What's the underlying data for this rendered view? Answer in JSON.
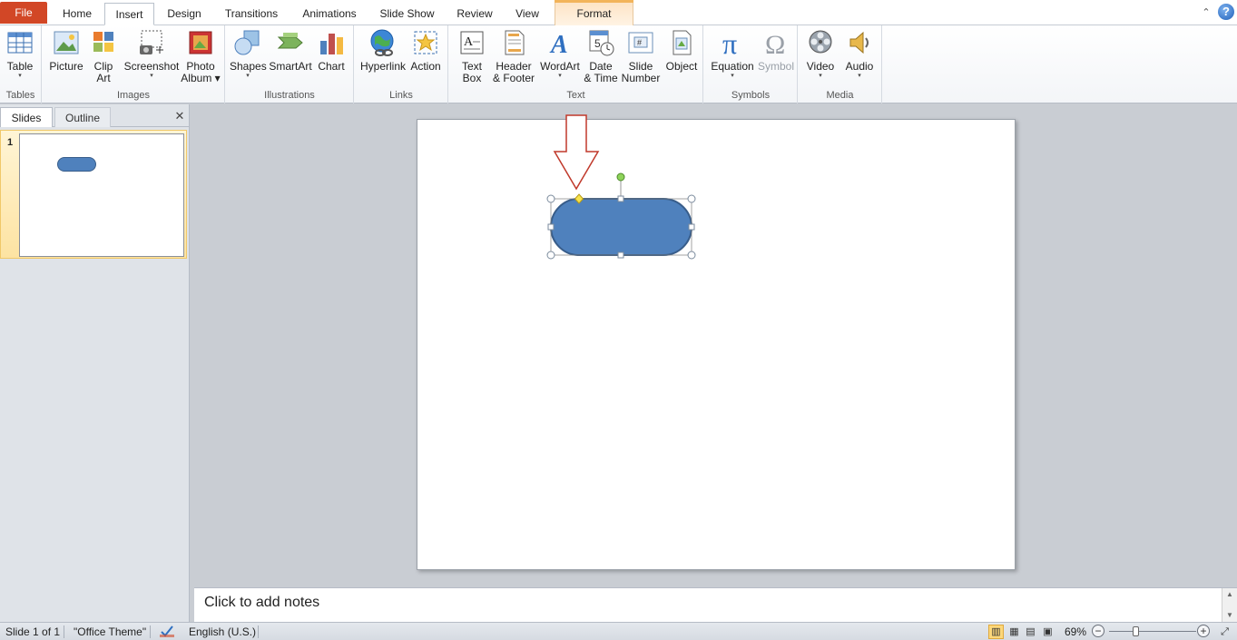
{
  "tabs": {
    "file": "File",
    "home": "Home",
    "insert": "Insert",
    "design": "Design",
    "transitions": "Transitions",
    "animations": "Animations",
    "slideshow": "Slide Show",
    "review": "Review",
    "view": "View",
    "format": "Format"
  },
  "ribbon": {
    "groups": {
      "tables": "Tables",
      "images": "Images",
      "illustrations": "Illustrations",
      "links": "Links",
      "text": "Text",
      "symbols": "Symbols",
      "media": "Media"
    },
    "buttons": {
      "table": "Table",
      "picture": "Picture",
      "clipart_1": "Clip",
      "clipart_2": "Art",
      "screenshot": "Screenshot",
      "photoalbum_1": "Photo",
      "photoalbum_2": "Album",
      "shapes": "Shapes",
      "smartart": "SmartArt",
      "chart": "Chart",
      "hyperlink": "Hyperlink",
      "action": "Action",
      "textbox_1": "Text",
      "textbox_2": "Box",
      "headerfooter_1": "Header",
      "headerfooter_2": "& Footer",
      "wordart": "WordArt",
      "datetime_1": "Date",
      "datetime_2": "& Time",
      "slidenumber_1": "Slide",
      "slidenumber_2": "Number",
      "object": "Object",
      "equation": "Equation",
      "symbol": "Symbol",
      "video": "Video",
      "audio": "Audio"
    },
    "dropdown_glyph": "▾"
  },
  "left_panel": {
    "tab_slides": "Slides",
    "tab_outline": "Outline",
    "close_glyph": "✕",
    "slide_number": "1"
  },
  "notes": {
    "placeholder": "Click to add notes"
  },
  "status": {
    "slide": "Slide 1 of 1",
    "theme": "\"Office Theme\"",
    "language": "English (U.S.)",
    "zoom": "69%",
    "zoom_level_percent": 69
  },
  "colors": {
    "file_tab": "#d24726",
    "shape_fill": "#4f81bd",
    "shape_border": "#385d8a",
    "arrow": "#c0392b",
    "format_accent": "#f2b45a"
  }
}
